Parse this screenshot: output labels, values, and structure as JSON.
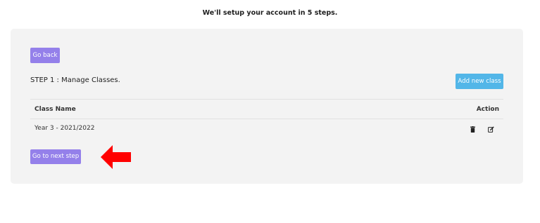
{
  "header": {
    "intro_text": "We'll setup your account in 5 steps."
  },
  "card": {
    "back_label": "Go back",
    "step_title": "STEP 1 : Manage Classes.",
    "add_label": "Add new class",
    "next_label": "Go to next step"
  },
  "table": {
    "columns": [
      "Class Name",
      "Action"
    ],
    "rows": [
      {
        "class_name": "Year 3 - 2021/2022"
      }
    ]
  },
  "icons": {
    "delete": "trash-icon",
    "edit": "edit-icon",
    "pointer": "arrow-left-icon"
  },
  "colors": {
    "purple_button": "#9480ea",
    "blue_button": "#52b6e8",
    "arrow": "#ff0000",
    "card_bg": "#f3f3f3"
  }
}
